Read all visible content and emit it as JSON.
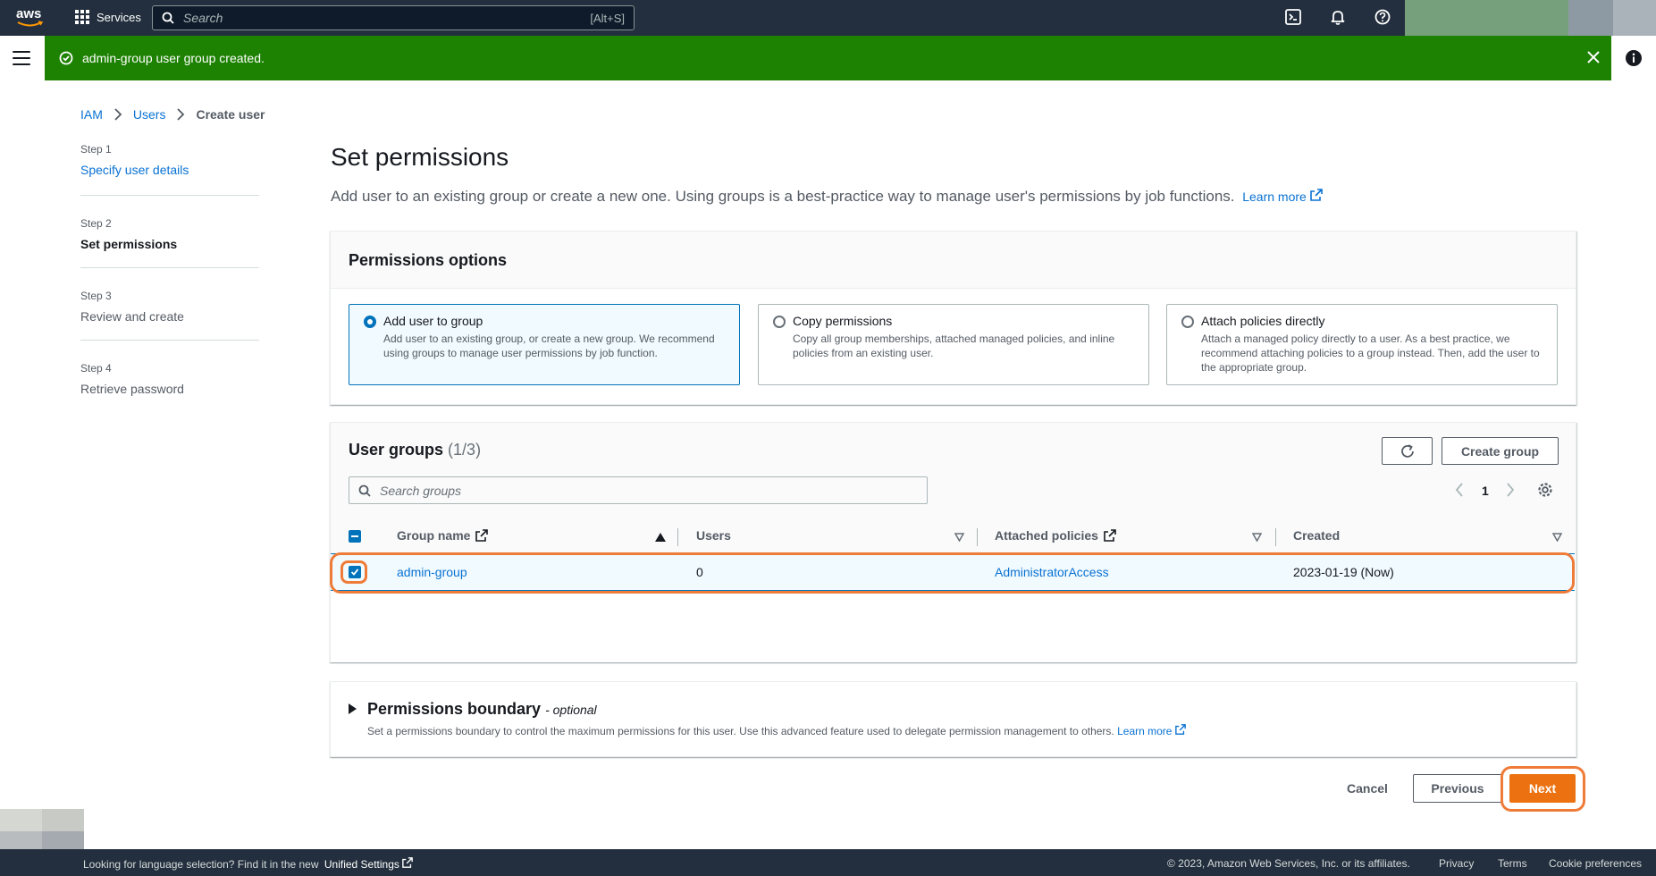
{
  "topnav": {
    "logo": "aws",
    "services_label": "Services",
    "search_placeholder": "Search",
    "search_shortcut": "[Alt+S]",
    "icons": [
      "cloudshell-icon",
      "notifications-bell-icon",
      "help-icon"
    ]
  },
  "flash": {
    "message": "admin-group user group created.",
    "color": "#1d8102"
  },
  "breadcrumb": {
    "items": [
      "IAM",
      "Users",
      "Create user"
    ]
  },
  "steps": [
    {
      "num": "Step 1",
      "label": "Specify user details"
    },
    {
      "num": "Step 2",
      "label": "Set permissions"
    },
    {
      "num": "Step 3",
      "label": "Review and create"
    },
    {
      "num": "Step 4",
      "label": "Retrieve password"
    }
  ],
  "page": {
    "title": "Set permissions",
    "subtitle": "Add user to an existing group or create a new one. Using groups is a best-practice way to manage user's permissions by job functions.",
    "learn_more": "Learn more"
  },
  "permissions_options": {
    "header": "Permissions options",
    "options": [
      {
        "title": "Add user to group",
        "desc": "Add user to an existing group, or create a new group. We recommend using groups to manage user permissions by job function.",
        "selected": true
      },
      {
        "title": "Copy permissions",
        "desc": "Copy all group memberships, attached managed policies, and inline policies from an existing user.",
        "selected": false
      },
      {
        "title": "Attach policies directly",
        "desc": "Attach a managed policy directly to a user. As a best practice, we recommend attaching policies to a group instead. Then, add the user to the appropriate group.",
        "selected": false
      }
    ]
  },
  "user_groups": {
    "header": "User groups",
    "count": "(1/3)",
    "create_button": "Create group",
    "search_placeholder": "Search groups",
    "page_number": "1",
    "columns": [
      "Group name",
      "Users",
      "Attached policies",
      "Created"
    ],
    "rows": [
      {
        "group_name": "admin-group",
        "users": "0",
        "policies": "AdministratorAccess",
        "created": "2023-01-19 (Now)",
        "checked": true
      }
    ]
  },
  "boundary": {
    "title": "Permissions boundary",
    "optional": "- optional",
    "desc": "Set a permissions boundary to control the maximum permissions for this user. Use this advanced feature used to delegate permission management to others.",
    "learn_more": "Learn more"
  },
  "actions": {
    "cancel": "Cancel",
    "previous": "Previous",
    "next": "Next",
    "next_color": "#ec7211"
  },
  "footer": {
    "lang_text": "Looking for language selection? Find it in the new",
    "unified_settings": "Unified Settings",
    "copyright": "© 2023, Amazon Web Services, Inc. or its affiliates.",
    "privacy": "Privacy",
    "terms": "Terms",
    "cookies": "Cookie preferences"
  }
}
